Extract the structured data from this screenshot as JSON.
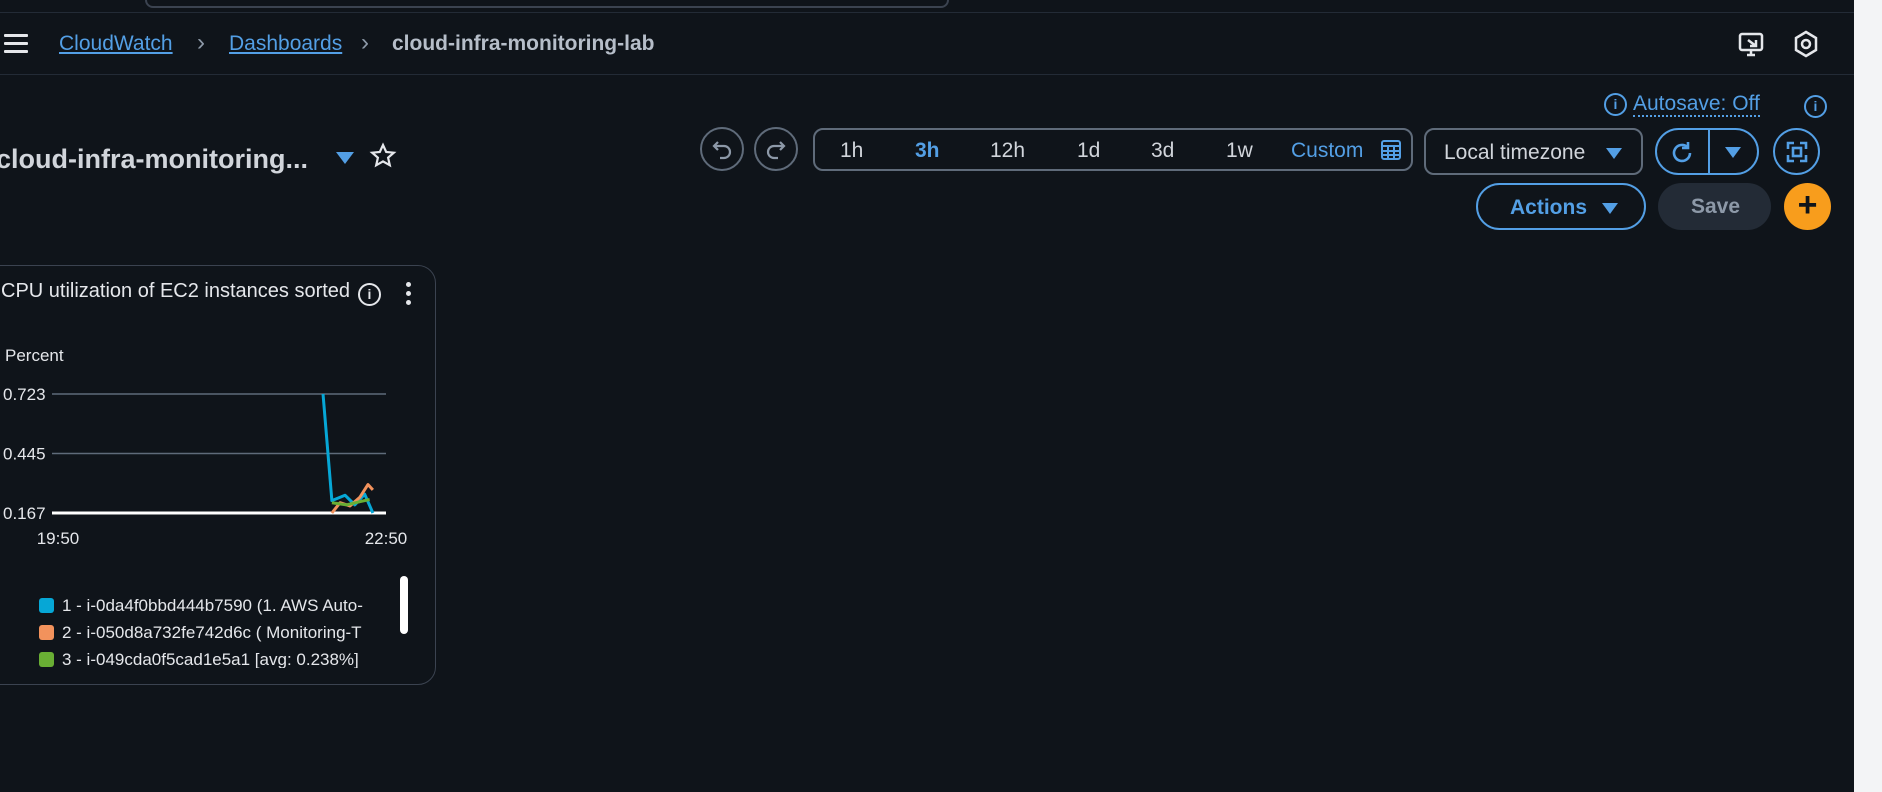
{
  "breadcrumbs": {
    "item1": "CloudWatch",
    "item2": "Dashboards",
    "current": "cloud-infra-monitoring-lab"
  },
  "autosave": {
    "label": "Autosave: Off"
  },
  "dashboard": {
    "title": "cloud-infra-monitoring..."
  },
  "time_range": {
    "options": [
      "1h",
      "3h",
      "12h",
      "1d",
      "3d",
      "1w"
    ],
    "selected": "3h",
    "custom_label": "Custom"
  },
  "timezone": {
    "label": "Local timezone"
  },
  "actions": {
    "actions_label": "Actions",
    "save_label": "Save",
    "add_label": "+"
  },
  "widget": {
    "title": "CPU utilization of EC2 instances sorted",
    "unit_label": "Percent",
    "legend": [
      {
        "label": "1 - i-0da4f0bbd444b7590 (1. AWS Auto-",
        "color": "#06a7d6"
      },
      {
        "label": "2 - i-050d8a732fe742d6c ( Monitoring-T",
        "color": "#f2925c"
      },
      {
        "label": "3 - i-049cda0f5cad1e5a1 [avg: 0.238%]",
        "color": "#69ae34"
      }
    ]
  },
  "chart_data": {
    "type": "line",
    "ylabel": "Percent",
    "y_ticks": [
      "0.723",
      "0.445",
      "0.167"
    ],
    "x_ticks": [
      "19:50",
      "22:50"
    ],
    "ylim": [
      0.167,
      0.723
    ],
    "series": [
      {
        "name": "1 - i-0da4f0bbd444b7590 (1. AWS Auto-",
        "color": "#06a7d6",
        "points": [
          [
            0.808,
            0.723
          ],
          [
            0.835,
            0.225
          ],
          [
            0.875,
            0.25
          ],
          [
            0.905,
            0.205
          ],
          [
            0.935,
            0.255
          ],
          [
            0.96,
            0.167
          ]
        ]
      },
      {
        "name": "2 - i-050d8a732fe742d6c ( Monitoring-T",
        "color": "#f2925c",
        "points": [
          [
            0.835,
            0.167
          ],
          [
            0.86,
            0.215
          ],
          [
            0.89,
            0.2
          ],
          [
            0.92,
            0.24
          ],
          [
            0.945,
            0.3
          ],
          [
            0.96,
            0.275
          ]
        ]
      },
      {
        "name": "3 - i-049cda0f5cad1e5a1 [avg: 0.238%]",
        "color": "#69ae34",
        "points": [
          [
            0.835,
            0.215
          ],
          [
            0.88,
            0.205
          ],
          [
            0.92,
            0.22
          ],
          [
            0.95,
            0.23
          ]
        ]
      }
    ]
  }
}
